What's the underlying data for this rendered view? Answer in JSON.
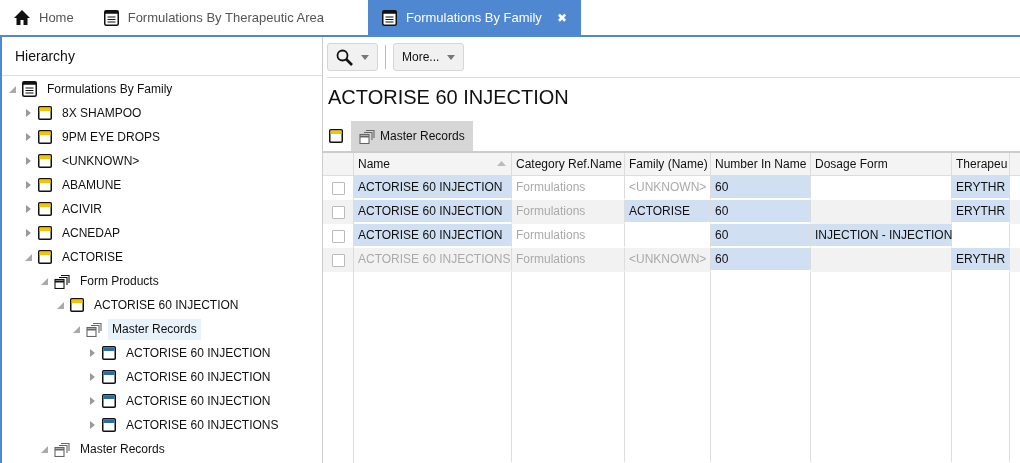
{
  "tabs": [
    {
      "label": "Home",
      "kind": "home",
      "selected": false,
      "closable": false
    },
    {
      "label": "Formulations By Therapeutic Area",
      "kind": "list",
      "selected": false,
      "closable": false
    },
    {
      "label": "Formulations By Family",
      "kind": "list",
      "selected": true,
      "closable": true
    }
  ],
  "close_glyph": "✖",
  "hierarchy": {
    "title": "Hierarchy",
    "tree": [
      {
        "label": "Formulations By Family",
        "kind": "list",
        "expanded": true,
        "selected": false,
        "children": [
          {
            "label": "8X SHAMPOO",
            "kind": "family",
            "expanded": false,
            "selected": false
          },
          {
            "label": "9PM EYE DROPS",
            "kind": "family",
            "expanded": false,
            "selected": false
          },
          {
            "label": "<UNKNOWN>",
            "kind": "family",
            "expanded": false,
            "selected": false
          },
          {
            "label": "ABAMUNE",
            "kind": "family",
            "expanded": false,
            "selected": false
          },
          {
            "label": "ACIVIR",
            "kind": "family",
            "expanded": false,
            "selected": false
          },
          {
            "label": "ACNEDAP",
            "kind": "family",
            "expanded": false,
            "selected": false
          },
          {
            "label": "ACTORISE",
            "kind": "family",
            "expanded": true,
            "selected": false,
            "children": [
              {
                "label": "Form Products",
                "kind": "stack",
                "expanded": true,
                "selected": false,
                "children": [
                  {
                    "label": "ACTORISE 60 INJECTION",
                    "kind": "family",
                    "expanded": true,
                    "selected": false,
                    "children": [
                      {
                        "label": "Master Records",
                        "kind": "stack-grey",
                        "expanded": true,
                        "selected": true,
                        "children": [
                          {
                            "label": "ACTORISE 60 INJECTION",
                            "kind": "record",
                            "expanded": false,
                            "selected": false
                          },
                          {
                            "label": "ACTORISE 60 INJECTION",
                            "kind": "record",
                            "expanded": false,
                            "selected": false
                          },
                          {
                            "label": "ACTORISE 60 INJECTION",
                            "kind": "record",
                            "expanded": false,
                            "selected": false
                          },
                          {
                            "label": "ACTORISE 60 INJECTIONS",
                            "kind": "record",
                            "expanded": false,
                            "selected": false
                          }
                        ]
                      }
                    ]
                  }
                ]
              },
              {
                "label": "Master Records",
                "kind": "stack-grey",
                "expanded": true,
                "selected": false
              }
            ]
          }
        ]
      }
    ]
  },
  "toolbar": {
    "more_label": "More..."
  },
  "title": "ACTORISE 60 INJECTION",
  "subtabs": [
    {
      "label": "Master Records",
      "selected": true
    }
  ],
  "table": {
    "columns": [
      {
        "label": "Name",
        "sorted": true
      },
      {
        "label": "Category Ref.Name",
        "sorted": false
      },
      {
        "label": "Family (Name)",
        "sorted": false
      },
      {
        "label": "Number In Name",
        "sorted": false
      },
      {
        "label": "Dosage Form",
        "sorted": false
      },
      {
        "label": "Therapeu",
        "sorted": false
      }
    ],
    "rows": [
      {
        "checked": false,
        "cells": [
          {
            "text": "ACTORISE 60 INJECTION",
            "highlighted": true,
            "dimmed": false
          },
          {
            "text": "Formulations",
            "highlighted": false,
            "dimmed": true
          },
          {
            "text": "<UNKNOWN>",
            "highlighted": false,
            "dimmed": true
          },
          {
            "text": "60",
            "highlighted": true,
            "dimmed": false
          },
          {
            "highlighted": false
          },
          {
            "text": "ERYTHR",
            "highlighted": true,
            "dimmed": false
          }
        ]
      },
      {
        "checked": false,
        "cells": [
          {
            "text": "ACTORISE 60 INJECTION",
            "highlighted": true,
            "dimmed": false
          },
          {
            "text": "Formulations",
            "highlighted": false,
            "dimmed": true
          },
          {
            "text": "ACTORISE",
            "highlighted": true,
            "dimmed": false
          },
          {
            "text": "60",
            "highlighted": true,
            "dimmed": false
          },
          {
            "highlighted": false
          },
          {
            "text": "ERYTHR",
            "highlighted": true,
            "dimmed": false
          }
        ]
      },
      {
        "checked": false,
        "cells": [
          {
            "text": "ACTORISE 60 INJECTION",
            "highlighted": true,
            "dimmed": false
          },
          {
            "text": "Formulations",
            "highlighted": false,
            "dimmed": true
          },
          {
            "highlighted": false
          },
          {
            "text": "60",
            "highlighted": true,
            "dimmed": false
          },
          {
            "text": "INJECTION - INJECTION",
            "highlighted": true,
            "dimmed": false
          },
          {
            "highlighted": false
          }
        ]
      },
      {
        "checked": false,
        "cells": [
          {
            "text": "ACTORISE 60 INJECTIONS",
            "highlighted": false,
            "dimmed": true
          },
          {
            "text": "Formulations",
            "highlighted": false,
            "dimmed": true
          },
          {
            "text": "<UNKNOWN>",
            "highlighted": false,
            "dimmed": true
          },
          {
            "text": "60",
            "highlighted": true,
            "dimmed": false
          },
          {
            "highlighted": false
          },
          {
            "text": "ERYTHR",
            "highlighted": true,
            "dimmed": false
          }
        ]
      }
    ]
  }
}
